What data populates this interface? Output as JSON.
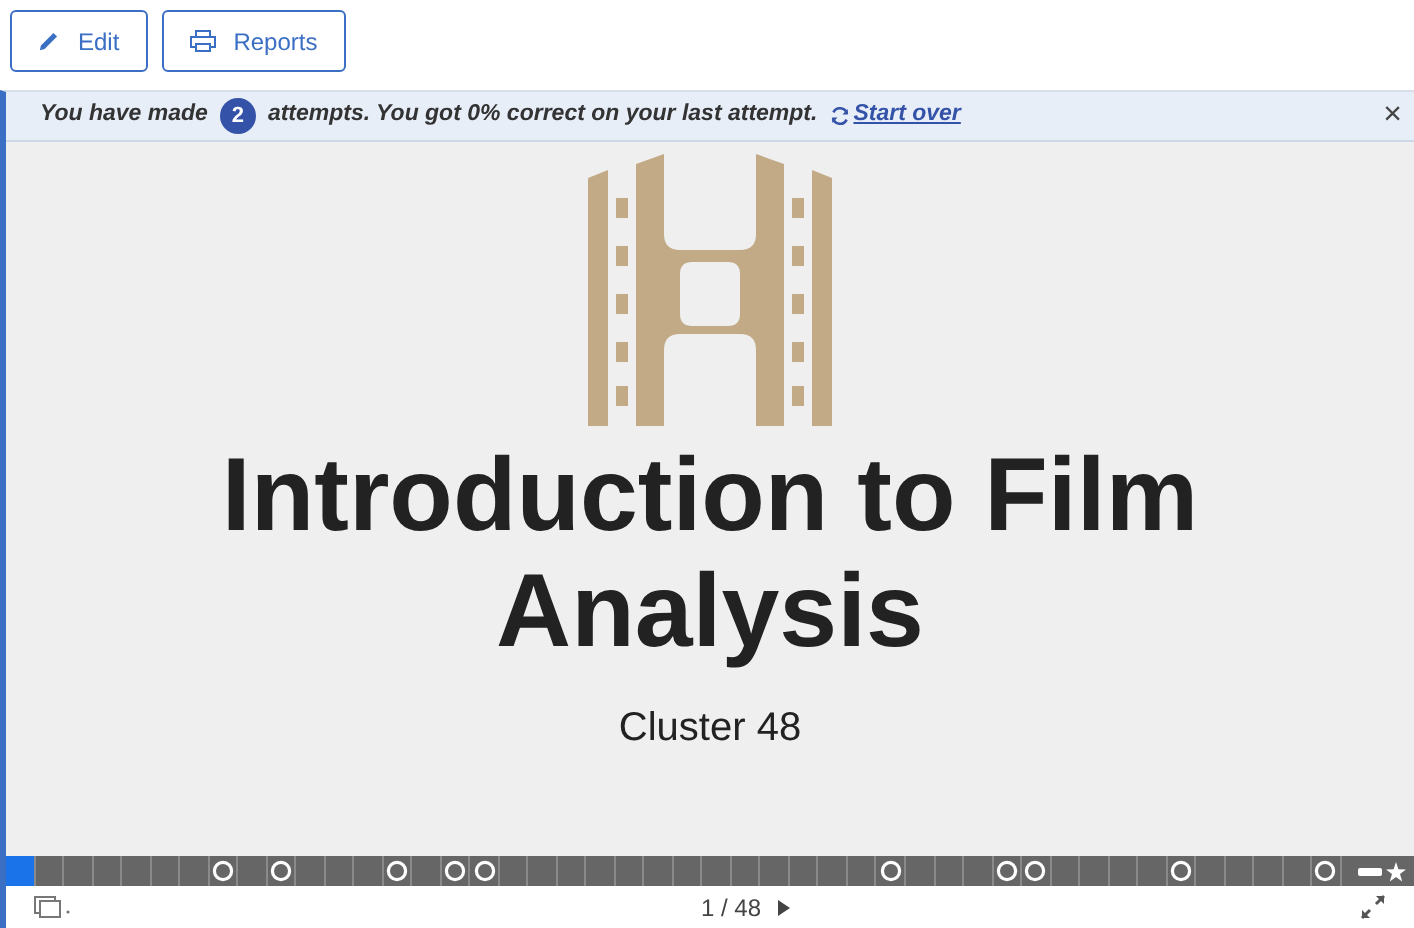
{
  "toolbar": [
    {
      "label": "Edit",
      "kind": "edit"
    },
    {
      "label": "Reports",
      "kind": "reports"
    }
  ],
  "banner": {
    "prefix": "You have made",
    "count": "2",
    "message": "attempts. You got 0% correct on your last attempt.",
    "link": "Start over",
    "close": "×"
  },
  "slide": {
    "title": "Introduction to Film Analysis",
    "subtitle": "Cluster 48"
  },
  "progress": [
    {
      "selected": true,
      "kind": "plain"
    },
    {
      "selected": false,
      "kind": "plain"
    },
    {
      "selected": false,
      "kind": "plain"
    },
    {
      "selected": false,
      "kind": "plain"
    },
    {
      "selected": false,
      "kind": "plain"
    },
    {
      "selected": false,
      "kind": "plain"
    },
    {
      "selected": false,
      "kind": "plain"
    },
    {
      "selected": false,
      "kind": "question"
    },
    {
      "selected": false,
      "kind": "plain"
    },
    {
      "selected": false,
      "kind": "question"
    },
    {
      "selected": false,
      "kind": "plain"
    },
    {
      "selected": false,
      "kind": "plain"
    },
    {
      "selected": false,
      "kind": "plain"
    },
    {
      "selected": false,
      "kind": "question"
    },
    {
      "selected": false,
      "kind": "plain"
    },
    {
      "selected": false,
      "kind": "question"
    },
    {
      "selected": false,
      "kind": "question"
    },
    {
      "selected": false,
      "kind": "plain"
    },
    {
      "selected": false,
      "kind": "plain"
    },
    {
      "selected": false,
      "kind": "plain"
    },
    {
      "selected": false,
      "kind": "plain"
    },
    {
      "selected": false,
      "kind": "plain"
    },
    {
      "selected": false,
      "kind": "plain"
    },
    {
      "selected": false,
      "kind": "plain"
    },
    {
      "selected": false,
      "kind": "plain"
    },
    {
      "selected": false,
      "kind": "plain"
    },
    {
      "selected": false,
      "kind": "plain"
    },
    {
      "selected": false,
      "kind": "plain"
    },
    {
      "selected": false,
      "kind": "plain"
    },
    {
      "selected": false,
      "kind": "plain"
    },
    {
      "selected": false,
      "kind": "question"
    },
    {
      "selected": false,
      "kind": "plain"
    },
    {
      "selected": false,
      "kind": "plain"
    },
    {
      "selected": false,
      "kind": "plain"
    },
    {
      "selected": false,
      "kind": "question"
    },
    {
      "selected": false,
      "kind": "question"
    },
    {
      "selected": false,
      "kind": "plain"
    },
    {
      "selected": false,
      "kind": "plain"
    },
    {
      "selected": false,
      "kind": "plain"
    },
    {
      "selected": false,
      "kind": "plain"
    },
    {
      "selected": false,
      "kind": "question"
    },
    {
      "selected": false,
      "kind": "plain"
    },
    {
      "selected": false,
      "kind": "plain"
    },
    {
      "selected": false,
      "kind": "plain"
    },
    {
      "selected": false,
      "kind": "plain"
    },
    {
      "selected": false,
      "kind": "question"
    }
  ],
  "pager": {
    "current": "1",
    "separator": "/",
    "total": "48"
  }
}
